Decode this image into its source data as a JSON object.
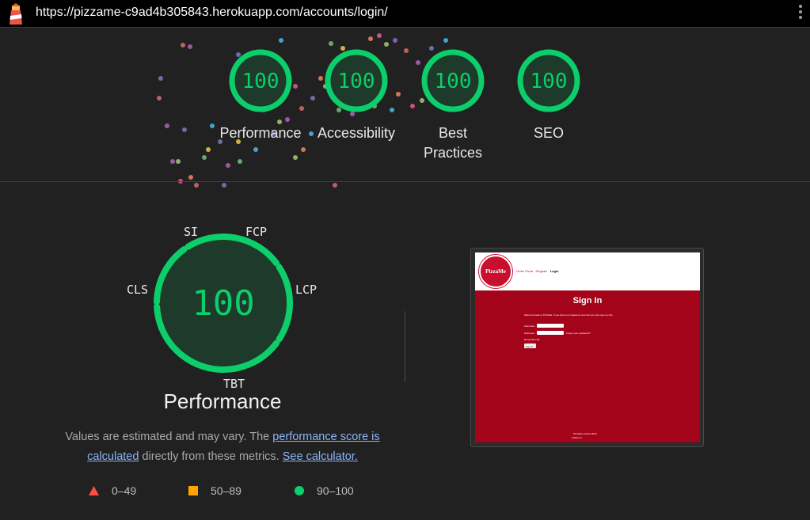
{
  "browser": {
    "url": "https://pizzame-c9ad4b305843.herokuapp.com/accounts/login/",
    "logo_icon": "lighthouse-icon",
    "menu_icon": "kebab-menu-icon"
  },
  "colors": {
    "pass": "#0cce6b",
    "pass_fill": "#1e3a2a",
    "average": "#ffa400",
    "fail": "#ff4e42",
    "link": "#8ab4f8"
  },
  "summary_scores": [
    {
      "score": "100",
      "label": "Performance"
    },
    {
      "score": "100",
      "label": "Accessibility"
    },
    {
      "score": "100",
      "label": "Best\nPractices"
    },
    {
      "score": "100",
      "label": "SEO"
    }
  ],
  "performance": {
    "score": "100",
    "title": "Performance",
    "metrics": {
      "si": "SI",
      "fcp": "FCP",
      "lcp": "LCP",
      "tbt": "TBT",
      "cls": "CLS"
    },
    "description": {
      "prefix": "Values are estimated and may vary. The ",
      "link1": "performance score is calculated",
      "middle": " directly from these metrics. ",
      "link2": "See calculator."
    },
    "legend": [
      {
        "icon": "triangle-fail-icon",
        "range": "0–49"
      },
      {
        "icon": "square-average-icon",
        "range": "50–89"
      },
      {
        "icon": "circle-pass-icon",
        "range": "90–100"
      }
    ]
  },
  "preview": {
    "logo_text": "PizzaMe",
    "nav": {
      "order": "Order Pizza",
      "register": "Register",
      "login": "Login"
    },
    "heading": "Sign In",
    "intro": "Welcome back to PizzaMe. If you have not created an account yet, then sign up first.",
    "username_label": "Username",
    "password_label": "Password",
    "forgot": "Forgot your password?",
    "remember": "Remember Me",
    "button": "Sign In",
    "footer": "PizzaMe Limited 2023",
    "follow": "Follow us:"
  }
}
